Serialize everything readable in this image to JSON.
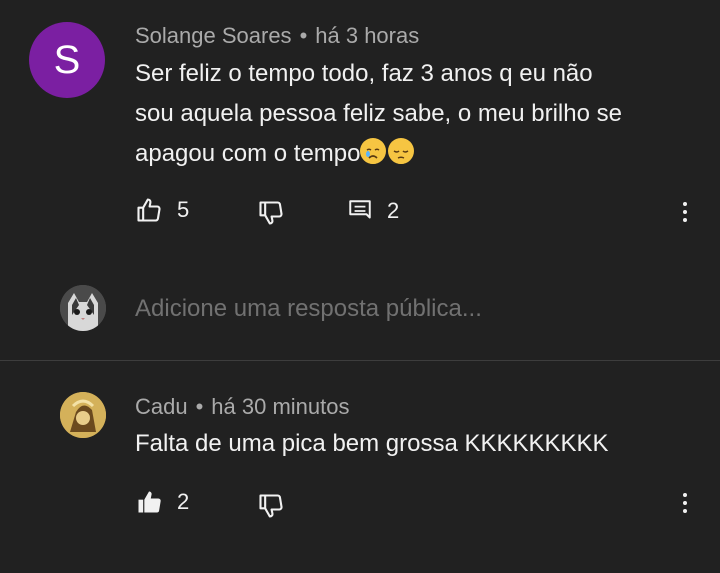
{
  "comments": [
    {
      "avatar_letter": "S",
      "author": "Solange Soares",
      "separator": "•",
      "time": "há 3 horas",
      "text_lines": [
        "Ser feliz o tempo todo, faz 3 anos q eu não",
        "sou aquela pessoa feliz sabe, o meu brilho se",
        "apagou com o tempo"
      ],
      "emojis": [
        "crying-face",
        "pensive-face"
      ],
      "likes": "5",
      "replies": "2",
      "liked": false
    },
    {
      "author": "Cadu",
      "separator": "•",
      "time": "há 30 minutos",
      "text": "Falta de uma pica bem grossa KKKKKKKKK",
      "likes": "2",
      "liked": true
    }
  ],
  "reply_box": {
    "placeholder": "Adicione uma resposta pública..."
  },
  "colors": {
    "background": "#212121",
    "avatar_purple": "#7b1fa2",
    "text_primary": "#f1f1f1",
    "text_secondary": "#aaaaaa",
    "placeholder": "#717171"
  }
}
